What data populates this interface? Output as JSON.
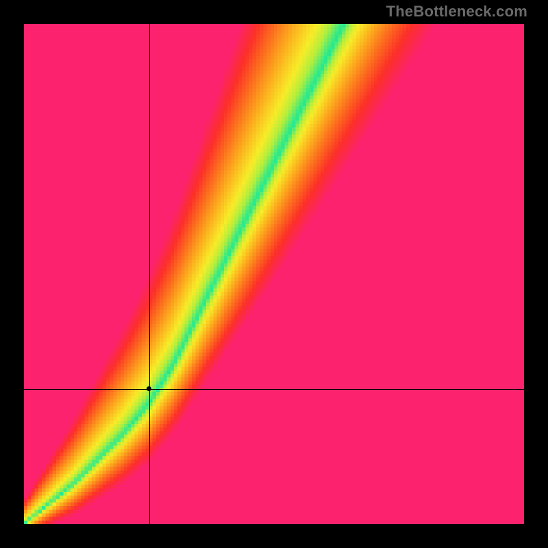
{
  "watermark": "TheBottleneck.com",
  "chart_data": {
    "type": "heatmap",
    "title": "",
    "xlabel": "",
    "ylabel": "",
    "xlim": [
      0,
      100
    ],
    "ylim": [
      0,
      100
    ],
    "grid": false,
    "legend": false,
    "pixelated": true,
    "grid_resolution": 140,
    "ideal_curve_description": "Thin green band along an optimal GPU-vs-CPU line; warm gradient outside (yellow→orange→red/pink).",
    "ideal_curve_samples": [
      {
        "x": 0,
        "y": 0
      },
      {
        "x": 10,
        "y": 8
      },
      {
        "x": 20,
        "y": 18
      },
      {
        "x": 25,
        "y": 24
      },
      {
        "x": 30,
        "y": 32
      },
      {
        "x": 35,
        "y": 42
      },
      {
        "x": 40,
        "y": 52
      },
      {
        "x": 45,
        "y": 62
      },
      {
        "x": 50,
        "y": 72
      },
      {
        "x": 55,
        "y": 82
      },
      {
        "x": 60,
        "y": 92
      },
      {
        "x": 64,
        "y": 100
      }
    ],
    "crosshair_point": {
      "x": 25,
      "y": 27
    },
    "annotations": [
      {
        "type": "vline",
        "x": 25
      },
      {
        "type": "hline",
        "y": 27
      },
      {
        "type": "point",
        "x": 25,
        "y": 27
      }
    ],
    "colorscale_description": "green at optimal line, through yellow, orange, red, to magenta/pink at extremes"
  }
}
